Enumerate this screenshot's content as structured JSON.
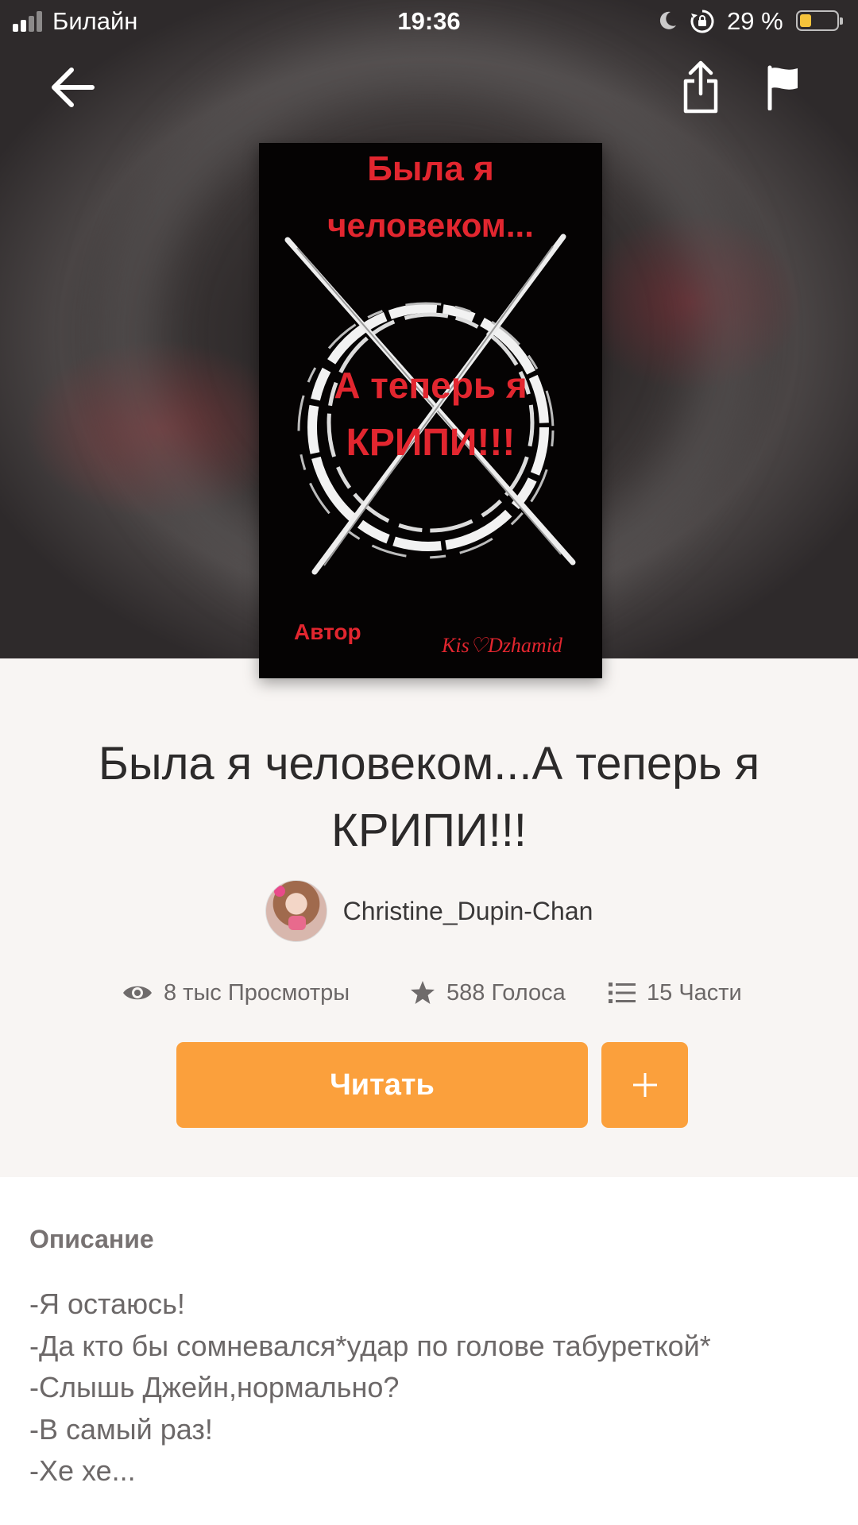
{
  "status_bar": {
    "carrier": "Билайн",
    "time": "19:36",
    "battery_percent": "29 %",
    "battery_level": 0.29,
    "signal_bars": 2
  },
  "top_bar": {
    "back_icon": "arrow-left-icon",
    "share_icon": "share-icon",
    "report_icon": "flag-icon"
  },
  "cover": {
    "line1": "Была я",
    "line2": "человеком...",
    "line3": "А теперь я",
    "line4": "КРИПИ!!!",
    "author_label": "Автор",
    "signature": "Kis♡Dzhamid"
  },
  "story": {
    "title": "Была я человеком...А теперь я КРИПИ!!!",
    "author": "Christine_Dupin-Chan"
  },
  "stats": {
    "views": "8 тыс Просмотры",
    "votes": "588 Голоса",
    "parts": "15 Части"
  },
  "actions": {
    "read_label": "Читать",
    "add_icon": "plus-icon"
  },
  "description": {
    "heading": "Описание",
    "lines": [
      "-Я остаюсь!",
      "-Да кто бы сомневался*удар по голове табуреткой*",
      "-Слышь Джейн,нормально?",
      "-В самый раз!",
      "-Хе хе..."
    ]
  },
  "colors": {
    "accent": "#fba03c",
    "cover_text": "#e2262f",
    "background": "#f8f5f3"
  }
}
